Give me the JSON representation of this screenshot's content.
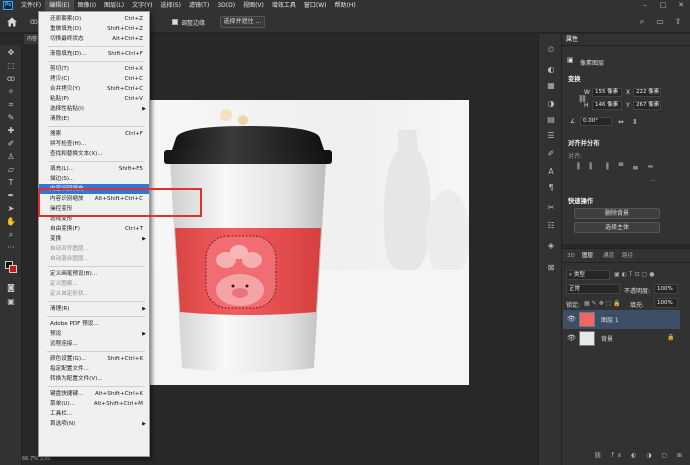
{
  "menubar": {
    "items": [
      {
        "label": "文件(F)",
        "active": false
      },
      {
        "label": "编辑(E)",
        "active": true
      },
      {
        "label": "图像(I)",
        "active": false
      },
      {
        "label": "图层(L)",
        "active": false
      },
      {
        "label": "文字(Y)",
        "active": false
      },
      {
        "label": "选择(S)",
        "active": false
      },
      {
        "label": "滤镜(T)",
        "active": false
      },
      {
        "label": "3D(D)",
        "active": false
      },
      {
        "label": "视图(V)",
        "active": false
      },
      {
        "label": "增效工具",
        "active": false
      },
      {
        "label": "窗口(W)",
        "active": false
      },
      {
        "label": "帮助(H)",
        "active": false
      }
    ],
    "logo": "Ps"
  },
  "options": {
    "check_label": "调整边缘",
    "select_button": "选择并遮住 ..."
  },
  "document_tab": "内容",
  "menu": [
    {
      "label": "还原套索(O)",
      "shortcut": "Ctrl+Z"
    },
    {
      "label": "重做填充(O)",
      "shortcut": "Shift+Ctrl+Z"
    },
    {
      "label": "切换最终状态",
      "shortcut": "Alt+Ctrl+Z"
    },
    {
      "sep": true
    },
    {
      "label": "渐隐填充(D)...",
      "shortcut": "Shift+Ctrl+F"
    },
    {
      "sep": true
    },
    {
      "label": "剪切(T)",
      "shortcut": "Ctrl+X"
    },
    {
      "label": "拷贝(C)",
      "shortcut": "Ctrl+C"
    },
    {
      "label": "合并拷贝(Y)",
      "shortcut": "Shift+Ctrl+C"
    },
    {
      "label": "粘贴(P)",
      "shortcut": "Ctrl+V"
    },
    {
      "label": "选择性粘贴(I)",
      "submenu": true
    },
    {
      "label": "清除(E)"
    },
    {
      "sep": true
    },
    {
      "label": "搜索",
      "shortcut": "Ctrl+F"
    },
    {
      "label": "拼写检查(H)..."
    },
    {
      "label": "查找和替换文本(X)..."
    },
    {
      "sep": true
    },
    {
      "label": "填充(L)...",
      "shortcut": "Shift+F5"
    },
    {
      "label": "描边(S)..."
    },
    {
      "label": "内容识别填充...",
      "highlight": true
    },
    {
      "label": "内容识别缩放",
      "shortcut": "Alt+Shift+Ctrl+C"
    },
    {
      "label": "操控变形"
    },
    {
      "label": "透视变形"
    },
    {
      "label": "自由变换(F)",
      "shortcut": "Ctrl+T"
    },
    {
      "label": "变换",
      "submenu": true
    },
    {
      "label": "自动对齐图层...",
      "disabled": true
    },
    {
      "label": "自动混合图层...",
      "disabled": true
    },
    {
      "sep": true
    },
    {
      "label": "定义画笔预设(B)..."
    },
    {
      "label": "定义图案...",
      "disabled": true
    },
    {
      "label": "定义自定形状...",
      "disabled": true
    },
    {
      "sep": true
    },
    {
      "label": "清理(R)",
      "submenu": true
    },
    {
      "sep": true
    },
    {
      "label": "Adobe PDF 预设..."
    },
    {
      "label": "预设",
      "submenu": true
    },
    {
      "label": "远程连接..."
    },
    {
      "sep": true
    },
    {
      "label": "颜色设置(G)...",
      "shortcut": "Shift+Ctrl+K"
    },
    {
      "label": "指定配置文件..."
    },
    {
      "label": "转换为配置文件(V)..."
    },
    {
      "sep": true
    },
    {
      "label": "键盘快捷键...",
      "shortcut": "Alt+Shift+Ctrl+K"
    },
    {
      "label": "菜单(U)...",
      "shortcut": "Alt+Shift+Ctrl+M"
    },
    {
      "label": "工具栏..."
    },
    {
      "label": "首选项(N)",
      "submenu": true
    }
  ],
  "properties": {
    "tab": "属性",
    "subtitle": "像素图层",
    "transform_title": "变换",
    "w_label": "W",
    "w_value": "155 像素",
    "x_label": "X",
    "x_value": "222 像素",
    "h_label": "H",
    "h_value": "146 像素",
    "y_label": "Y",
    "y_value": "267 像素",
    "angle": "0.00°",
    "align_title": "对齐并分布",
    "align_sub": "对齐:",
    "quick_title": "快速操作",
    "remove_bg": "删除背景",
    "select_subject": "选择主体"
  },
  "layers": {
    "tabs": [
      "3D",
      "图层",
      "通道",
      "路径"
    ],
    "kind": "类型",
    "blend": "正常",
    "opacity_label": "不透明度:",
    "opacity": "100%",
    "lock_label": "锁定:",
    "fill_label": "填充:",
    "fill": "100%",
    "items": [
      {
        "name": "图层 1",
        "selected": true
      },
      {
        "name": "背景",
        "selected": false
      }
    ]
  },
  "status": {
    "zoom": "66.7%",
    "doc": "文档:"
  }
}
